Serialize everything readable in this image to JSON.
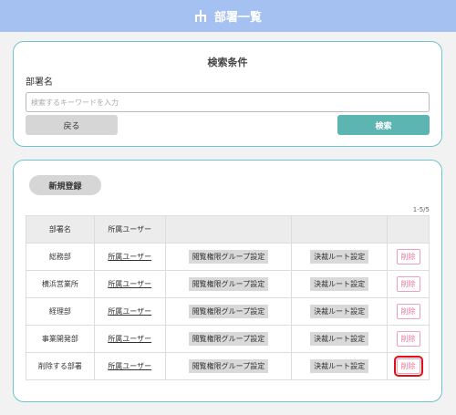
{
  "header": {
    "title": "部署一覧",
    "icon": "org-chart-icon"
  },
  "search": {
    "title": "検索条件",
    "field_label": "部署名",
    "placeholder": "検索するキーワードを入力",
    "back_label": "戻る",
    "search_label": "検索"
  },
  "list": {
    "new_label": "新規登録",
    "count": "1-5/5",
    "columns": [
      "部署名",
      "所属ユーザー",
      "",
      "",
      ""
    ],
    "rows": [
      {
        "dept": "総務部",
        "users": "所属ユーザー",
        "perm": "閲覧権限グループ設定",
        "route": "決裁ルート設定",
        "del": "削除"
      },
      {
        "dept": "横浜営業所",
        "users": "所属ユーザー",
        "perm": "閲覧権限グループ設定",
        "route": "決裁ルート設定",
        "del": "削除"
      },
      {
        "dept": "経理部",
        "users": "所属ユーザー",
        "perm": "閲覧権限グループ設定",
        "route": "決裁ルート設定",
        "del": "削除"
      },
      {
        "dept": "事業開発部",
        "users": "所属ユーザー",
        "perm": "閲覧権限グループ設定",
        "route": "決裁ルート設定",
        "del": "削除"
      },
      {
        "dept": "削除する部署",
        "users": "所属ユーザー",
        "perm": "閲覧権限グループ設定",
        "route": "決裁ルート設定",
        "del": "削除"
      }
    ]
  },
  "colors": {
    "header": "#a4c1f1",
    "accent": "#5cb5b1",
    "border": "#6ec3cf",
    "delete": "#e77a9b",
    "highlight": "#e0101a"
  }
}
